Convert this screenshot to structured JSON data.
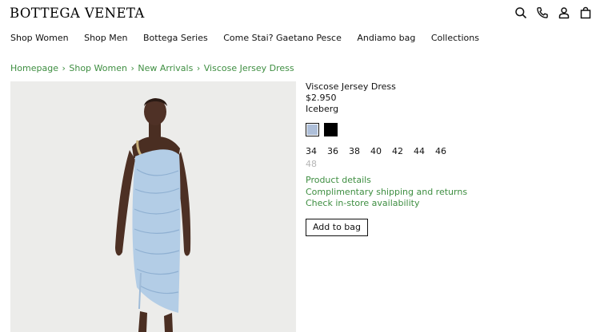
{
  "header": {
    "logo": "BOTTEGA VENETA",
    "icons": [
      "search-icon",
      "phone-icon",
      "account-icon",
      "bag-icon"
    ]
  },
  "nav": {
    "items": [
      "Shop Women",
      "Shop Men",
      "Bottega Series",
      "Come Stai? Gaetano Pesce",
      "Andiamo bag",
      "Collections"
    ]
  },
  "breadcrumb": {
    "items": [
      "Homepage",
      "Shop Women",
      "New Arrivals",
      "Viscose Jersey Dress"
    ],
    "separator": "›"
  },
  "product": {
    "name": "Viscose Jersey Dress",
    "price": "$2.950",
    "color_name": "Iceberg",
    "swatches": [
      {
        "name": "Iceberg",
        "hex": "#aebfd9",
        "selected": true
      },
      {
        "name": "Black",
        "hex": "#000000",
        "selected": false
      }
    ],
    "sizes": [
      {
        "label": "34",
        "available": true
      },
      {
        "label": "36",
        "available": true
      },
      {
        "label": "38",
        "available": true
      },
      {
        "label": "40",
        "available": true
      },
      {
        "label": "42",
        "available": true
      },
      {
        "label": "44",
        "available": true
      },
      {
        "label": "46",
        "available": true
      },
      {
        "label": "48",
        "available": false
      }
    ],
    "links": [
      "Product details",
      "Complimentary shipping and returns",
      "Check in-store availability"
    ],
    "add_to_bag": "Add to bag"
  },
  "colors": {
    "link": "#3e8e41",
    "image_background": "#ececea",
    "unavailable": "#b5b5b5"
  }
}
